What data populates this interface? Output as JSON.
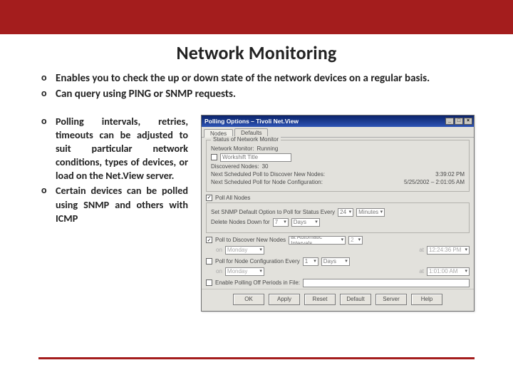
{
  "page": {
    "title": "Network Monitoring",
    "bullets_top": [
      "Enables you to check the up or down state of the network devices on a regular basis.",
      "Can query using PING or SNMP requests."
    ],
    "bullets_left": [
      "Polling intervals, retries, timeouts can be adjusted to suit particular network conditions, types of devices, or load on the Net.View server.",
      "Certain devices can be polled using SNMP and others with ICMP"
    ]
  },
  "dialog": {
    "titlebar": "Polling Options – Tivoli Net.View",
    "min": "_",
    "max": "□",
    "close": "×",
    "tabs": {
      "a": "Nodes",
      "b": "Defaults"
    },
    "group1": {
      "legend": "Status of Network Monitor",
      "status_label": "Network Monitor:",
      "status_value": "Running",
      "workshift_cb": "",
      "workshift_label": "Workshift Title",
      "discovered_label": "Discovered Nodes:",
      "discovered_value": "30",
      "poll1_label": "Next Scheduled Poll to Discover New Nodes:",
      "poll1_value": "3:39:02 PM",
      "poll2_label": "Next Scheduled Poll for Node Configuration:",
      "poll2_value": "5/25/2002 – 2:01:05 AM"
    },
    "poll_all": {
      "cb": "✓",
      "label": "Poll All Nodes",
      "set_label": "Set SNMP Default Option to Poll for Status Every",
      "num": "24",
      "unit": "Minutes",
      "delete_label": "Delete Nodes Down for",
      "del_num": "7",
      "del_unit": "Days"
    },
    "discover": {
      "cb": "✓",
      "label": "Poll to Discover New Nodes",
      "interval_label": "at Automatic Intervals",
      "int_num": "2",
      "on_label": "on",
      "on_day": "Monday",
      "at_label": "at",
      "at_time": "12:24:36 PM"
    },
    "config": {
      "cb": "",
      "label": "Poll for Node Configuration Every",
      "num": "1",
      "unit": "Days",
      "on_label": "on",
      "on_day": "Monday",
      "at_label": "at",
      "at_time": "1:01:00 AM"
    },
    "off_periods": {
      "cb": "",
      "label": "Enable Polling Off Periods in File:",
      "file": ""
    },
    "buttons": {
      "ok": "OK",
      "apply": "Apply",
      "reset": "Reset",
      "default": "Default",
      "server": "Server",
      "help": "Help"
    }
  }
}
